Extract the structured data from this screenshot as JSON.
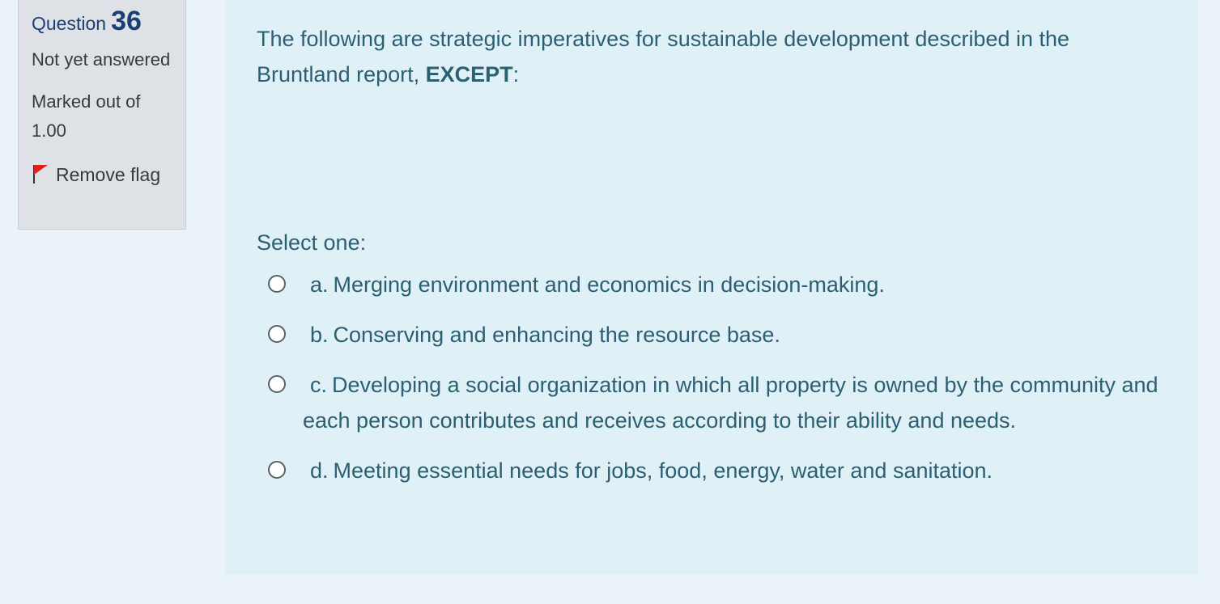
{
  "info": {
    "question_label": "Question",
    "question_number": "36",
    "state": "Not yet answered",
    "grade": "Marked out of 1.00",
    "flag_label": "Remove flag",
    "flag_color": "#e0201b"
  },
  "question": {
    "text_before": "The following are strategic imperatives for sustainable development described in the Bruntland report, ",
    "text_emphasis": "EXCEPT",
    "text_after": ":",
    "prompt": "Select one:",
    "answers": [
      {
        "letter": "a.",
        "text": "Merging environment and economics in decision-making."
      },
      {
        "letter": "b.",
        "text": "Conserving and enhancing the resource base."
      },
      {
        "letter": "c.",
        "text": "Developing a social organization in which all property is owned by the community and each person contributes and receives according to their ability and needs."
      },
      {
        "letter": "d.",
        "text": "Meeting essential needs for jobs, food, energy, water and sanitation."
      }
    ]
  },
  "colors": {
    "page_background": "#eaf3f8",
    "info_background": "#dee2e6",
    "content_background": "#dff0f7",
    "question_number_color": "#1b3e73",
    "content_text_color": "#2b5f72"
  }
}
